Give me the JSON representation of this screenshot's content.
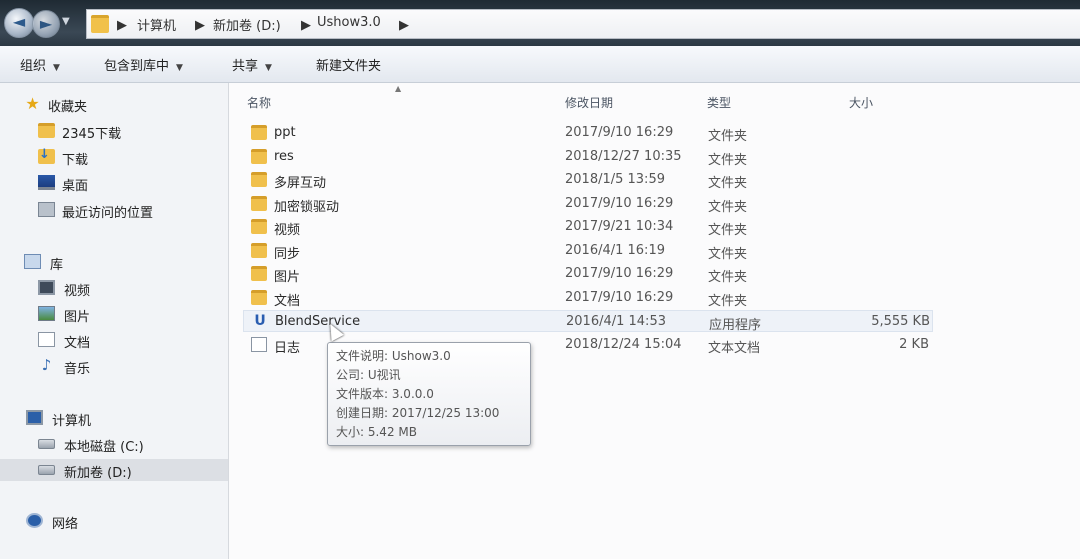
{
  "breadcrumb": [
    "计算机",
    "新加卷 (D:)",
    "Ushow3.0"
  ],
  "toolbar": {
    "organize": "组织",
    "include_library": "包含到库中",
    "share": "共享",
    "new_folder": "新建文件夹"
  },
  "nav": {
    "favorites": {
      "header": "收藏夹",
      "items": [
        "2345下载",
        "下载",
        "桌面",
        "最近访问的位置"
      ]
    },
    "libraries": {
      "header": "库",
      "items": [
        "视频",
        "图片",
        "文档",
        "音乐"
      ]
    },
    "computer": {
      "header": "计算机",
      "items": [
        "本地磁盘 (C:)",
        "新加卷 (D:)"
      ],
      "selected": "新加卷 (D:)"
    },
    "network": {
      "header": "网络"
    }
  },
  "columns": {
    "name": "名称",
    "date": "修改日期",
    "type": "类型",
    "size": "大小"
  },
  "files": [
    {
      "name": "ppt",
      "date": "2017/9/10 16:29",
      "type": "文件夹",
      "size": "",
      "icon": "folder-icon"
    },
    {
      "name": "res",
      "date": "2018/12/27 10:35",
      "type": "文件夹",
      "size": "",
      "icon": "folder-icon"
    },
    {
      "name": "多屏互动",
      "date": "2018/1/5 13:59",
      "type": "文件夹",
      "size": "",
      "icon": "folder-icon"
    },
    {
      "name": "加密锁驱动",
      "date": "2017/9/10 16:29",
      "type": "文件夹",
      "size": "",
      "icon": "folder-icon"
    },
    {
      "name": "视频",
      "date": "2017/9/21 10:34",
      "type": "文件夹",
      "size": "",
      "icon": "folder-icon"
    },
    {
      "name": "同步",
      "date": "2016/4/1 16:19",
      "type": "文件夹",
      "size": "",
      "icon": "folder-icon"
    },
    {
      "name": "图片",
      "date": "2017/9/10 16:29",
      "type": "文件夹",
      "size": "",
      "icon": "folder-icon"
    },
    {
      "name": "文档",
      "date": "2017/9/10 16:29",
      "type": "文件夹",
      "size": "",
      "icon": "folder-icon"
    },
    {
      "name": "BlendService",
      "date": "2016/4/1 14:53",
      "type": "应用程序",
      "size": "5,555 KB",
      "icon": "app-icon"
    },
    {
      "name": "日志",
      "date": "2018/12/24 15:04",
      "type": "文本文档",
      "size": "2 KB",
      "icon": "text-file-icon"
    }
  ],
  "tooltip": [
    "文件说明: Ushow3.0",
    "公司: U视讯",
    "文件版本: 3.0.0.0",
    "创建日期: 2017/12/25 13:00",
    "大小: 5.42 MB"
  ]
}
